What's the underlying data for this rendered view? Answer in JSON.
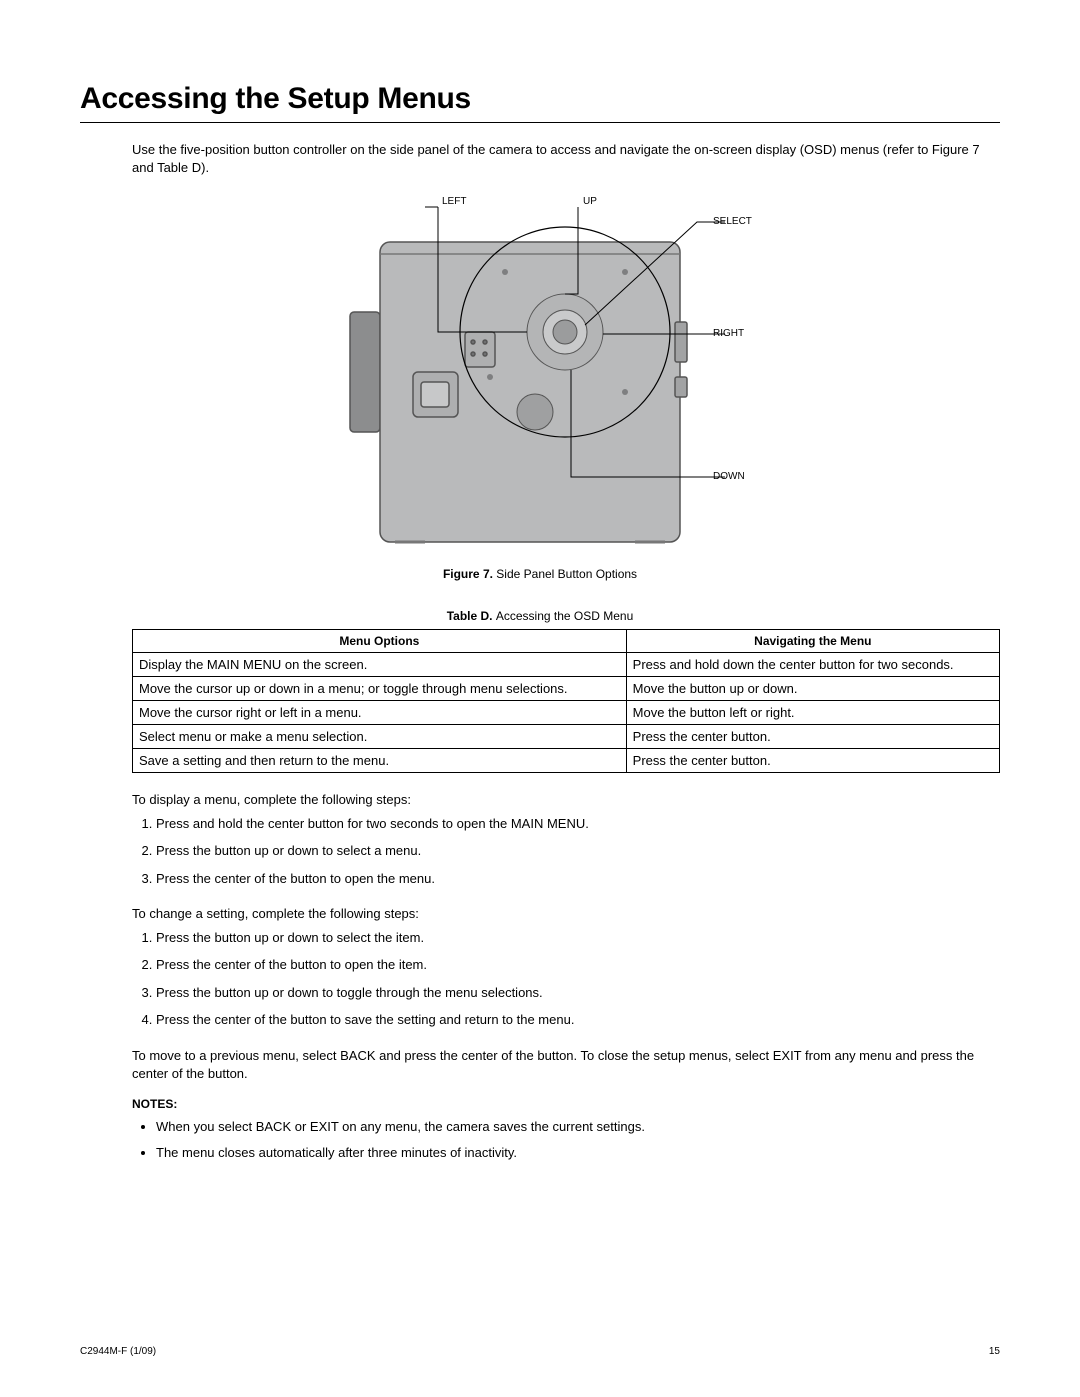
{
  "title": "Accessing the Setup Menus",
  "intro": "Use the five-position button controller on the side panel of the camera to access and navigate the on-screen display (OSD) menus (refer to Figure 7 and Table D).",
  "figure": {
    "labels": {
      "left": "LEFT",
      "up": "UP",
      "select": "SELECT",
      "right": "RIGHT",
      "down": "DOWN"
    },
    "caption_prefix": "Figure 7.",
    "caption": "Side Panel Button Options"
  },
  "table": {
    "title_prefix": "Table D.",
    "title": "Accessing the OSD Menu",
    "headers": {
      "options": "Menu Options",
      "nav": "Navigating the Menu"
    },
    "rows": [
      {
        "options": "Display the MAIN MENU on the screen.",
        "nav": "Press and hold down the center button for two seconds."
      },
      {
        "options": "Move the cursor up or down in a menu; or toggle through menu selections.",
        "nav": "Move the button up or down."
      },
      {
        "options": "Move the cursor right or left in a menu.",
        "nav": "Move the button left or right."
      },
      {
        "options": "Select menu or make a menu selection.",
        "nav": "Press the center button."
      },
      {
        "options": "Save a setting and then return to the menu.",
        "nav": "Press the center button."
      }
    ]
  },
  "display_intro": "To display a menu, complete the following steps:",
  "display_steps": [
    "Press and hold the center button for two seconds to open the MAIN MENU.",
    "Press the button up or down to select a menu.",
    "Press the center of the button to open the menu."
  ],
  "change_intro": "To change a setting, complete the following steps:",
  "change_steps": [
    "Press the button up or down to select the item.",
    "Press the center of the button to open the item.",
    "Press the button up or down to toggle through the menu selections.",
    "Press the center of the button to save the setting and return to the menu."
  ],
  "move_back": "To move to a previous menu, select BACK and press the center of the button. To close the setup menus, select EXIT from any menu and press the center of the button.",
  "notes_heading": "NOTES:",
  "notes": [
    "When you select BACK or EXIT on any menu, the camera saves the current settings.",
    "The menu closes automatically after three minutes of inactivity."
  ],
  "footer": {
    "left": "C2944M-F (1/09)",
    "right": "15"
  }
}
